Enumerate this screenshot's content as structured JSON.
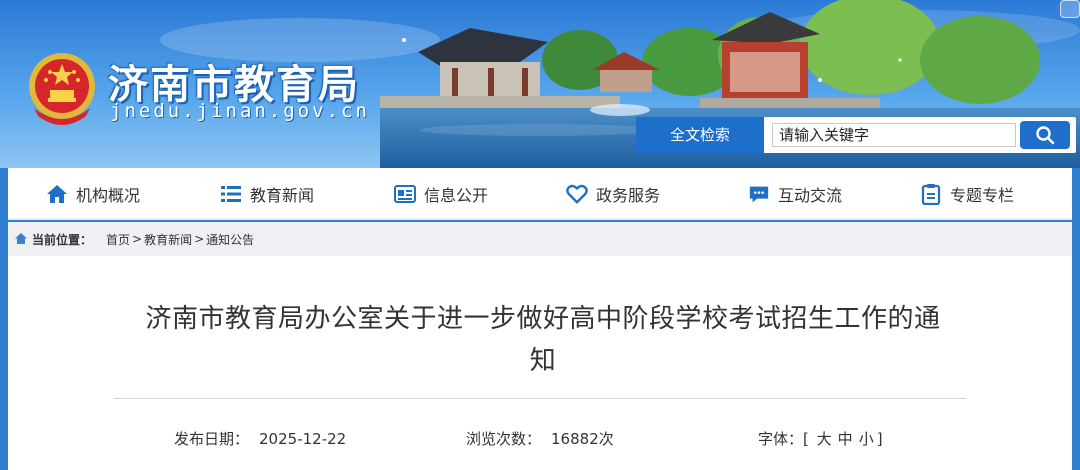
{
  "header": {
    "site_name": "济南市教育局",
    "site_domain": "jnedu.jinan.gov.cn",
    "emblem_icon": "national-emblem-icon"
  },
  "search": {
    "label": "全文检索",
    "placeholder": "请输入关键字",
    "button_icon": "search-icon"
  },
  "nav": {
    "items": [
      {
        "label": "机构概况",
        "icon": "home-icon"
      },
      {
        "label": "教育新闻",
        "icon": "list-icon"
      },
      {
        "label": "信息公开",
        "icon": "document-icon"
      },
      {
        "label": "政务服务",
        "icon": "heart-icon"
      },
      {
        "label": "互动交流",
        "icon": "chat-icon"
      },
      {
        "label": "专题专栏",
        "icon": "clipboard-icon"
      }
    ]
  },
  "breadcrumb": {
    "label": "当前位置：",
    "items": [
      "首页",
      "教育新闻",
      "通知公告"
    ],
    "separator": ">"
  },
  "article": {
    "title_line1": "济南市教育局办公室关于进一步做好高中阶段学校考试招生工作的通",
    "title_line2": "知",
    "publish_label": "发布日期：",
    "publish_date": "2025-12-22",
    "views_label": "浏览次数：",
    "views_value": "16882次",
    "font_label": "字体：",
    "font_bracket_open": "[",
    "font_bracket_close": "]",
    "font_options": [
      "大",
      "中",
      "小"
    ]
  },
  "colors": {
    "brand_blue": "#1e6fcc",
    "nav_icon_blue": "#1f6fc5",
    "banner_blue": "#2a78d4"
  }
}
